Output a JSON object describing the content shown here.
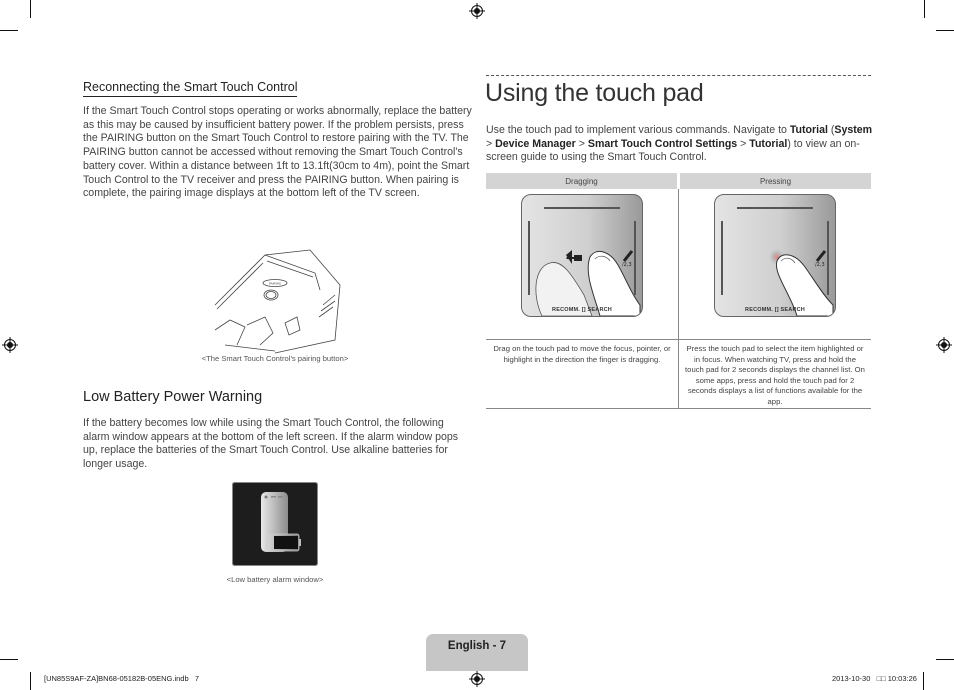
{
  "left_column": {
    "section_title": "Reconnecting the Smart Touch Control",
    "paragraph_1": "If the Smart Touch Control stops operating or works abnormally, replace the battery as this may be caused by insufficient battery power. If the problem persists, press the PAIRING button on the Smart Touch Control to restore pairing with the TV. The PAIRING button cannot be accessed without removing the Smart Touch Control's battery cover. Within a distance between 1ft to 13.1ft(30cm to 4m), point the Smart Touch Control to the TV receiver and press the PAIRING button. When pairing is complete, the pairing image displays at the bottom left of the TV screen.",
    "figure_1_caption": "<The Smart Touch Control's pairing button>",
    "heading_2": "Low Battery Power Warning",
    "paragraph_2": "If the battery becomes low while using the Smart Touch Control, the following alarm window appears at the bottom of the left screen. If the alarm window pops up, replace the batteries of the Smart Touch Control. Use alkaline batteries for longer usage.",
    "figure_2_caption": "<Low battery alarm window>"
  },
  "right_column": {
    "title": "Using the touch pad",
    "intro": {
      "before": "Use the touch pad to implement various commands. Navigate to ",
      "tutorial": "Tutorial",
      "open_paren": " (",
      "system": "System",
      "sep1": " > ",
      "device_manager": "Device Manager",
      "sep2": " > ",
      "settings": "Smart Touch Control Settings",
      "sep3": " > ",
      "tutorial2": "Tutorial",
      "after": ") to view an on-screen guide to using the Smart Touch Control."
    },
    "table": {
      "columns": [
        {
          "header": "Dragging",
          "pad_label": "RECOMM. [] SEARCH",
          "description": "Drag on the touch pad to move the focus, pointer, or highlight in the direction the finger is dragging."
        },
        {
          "header": "Pressing",
          "pad_label": "RECOMM. [] SEARCH",
          "description": "Press the touch pad to select the item highlighted or in focus. When watching TV, press and hold the touch pad for 2 seconds displays the channel list. On some apps, press and hold the touch pad for 2 seconds displays a list of functions available for the app."
        }
      ]
    }
  },
  "footer": {
    "page_label": "English - 7",
    "file_info": "[UN85S9AF-ZA]BN68-05182B-05ENG.indb   7",
    "timestamp": "2013-10-30   □□ 10:03:26"
  },
  "colors": {
    "table_header_bg": "#d4d4d4",
    "page_tab_bg": "#c6c6c6",
    "alarm_bg": "#1d1d1d"
  }
}
